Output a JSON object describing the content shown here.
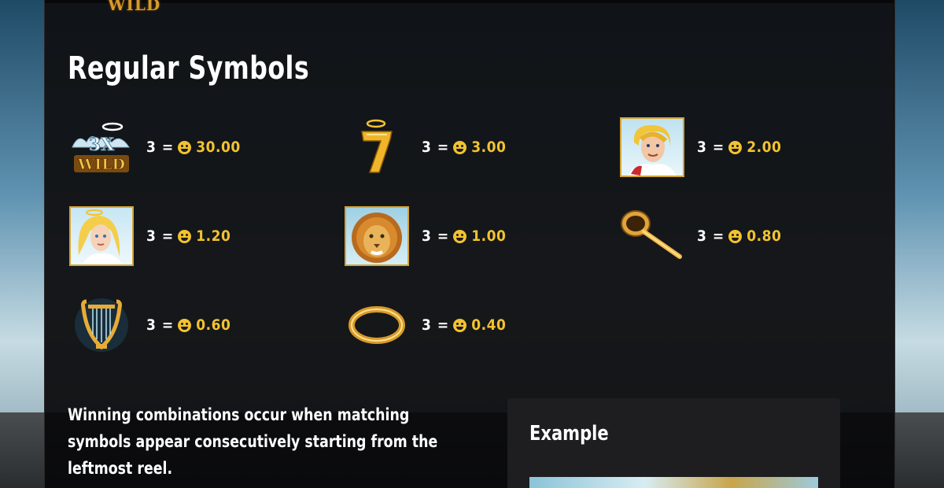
{
  "colors": {
    "gold": "#f2c230",
    "panel": "#0a0a0c",
    "frame": "#d2a43a"
  },
  "top_logo_text": "WILD",
  "section_title": "Regular Symbols",
  "symbols": [
    {
      "icon": "3x-wild-icon",
      "logo_text": "3X WILD",
      "count": "3",
      "eq": "=",
      "amount": "30.00"
    },
    {
      "icon": "seven-halo-icon",
      "count": "3",
      "eq": "=",
      "amount": "3.00"
    },
    {
      "icon": "angel-man-icon",
      "count": "3",
      "eq": "=",
      "amount": "2.00"
    },
    {
      "icon": "angel-woman-icon",
      "count": "3",
      "eq": "=",
      "amount": "1.20"
    },
    {
      "icon": "lion-icon",
      "count": "3",
      "eq": "=",
      "amount": "1.00"
    },
    {
      "icon": "trumpet-icon",
      "count": "3",
      "eq": "=",
      "amount": "0.80"
    },
    {
      "icon": "harp-icon",
      "count": "3",
      "eq": "=",
      "amount": "0.60"
    },
    {
      "icon": "halo-ring-icon",
      "count": "3",
      "eq": "=",
      "amount": "0.40"
    }
  ],
  "description": "Winning combinations occur when matching symbols appear consecutively starting from the leftmost reel.",
  "example": {
    "title": "Example"
  }
}
